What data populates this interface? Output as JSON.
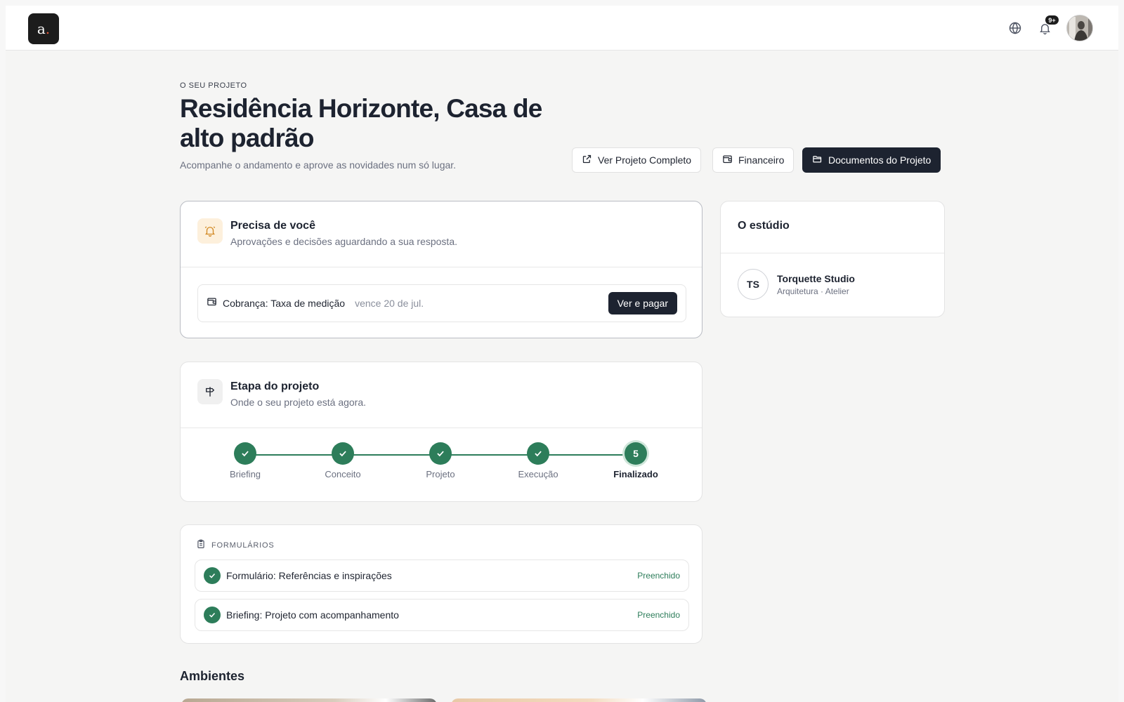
{
  "topbar": {
    "logo_letter": "a",
    "logo_dot": ".",
    "language_icon": "globe-icon",
    "notifications_icon": "bell-icon",
    "notifications_badge": "9+",
    "avatar_icon": "user-avatar"
  },
  "header": {
    "eyebrow": "O SEU PROJETO",
    "title": "Residência Horizonte, Casa de alto padrão",
    "subtitle": "Acompanhe o andamento e aprove as novidades num só lugar.",
    "buttons": [
      {
        "label": "Ver Projeto Completo",
        "icon": "external-link-icon"
      },
      {
        "label": "Financeiro",
        "icon": "wallet-icon"
      },
      {
        "label": "Documentos do Projeto",
        "icon": "folder-icon"
      }
    ]
  },
  "attention": {
    "icon": "bell-ring-icon",
    "title": "Precisa de você",
    "subtitle": "Aprovações e decisões aguardando a sua resposta.",
    "charge": {
      "icon": "wallet-icon",
      "label": "Cobrança: Taxa de medição",
      "due": "vence 20 de jul.",
      "action": "Ver e pagar"
    }
  },
  "stage": {
    "icon": "signpost-icon",
    "title": "Etapa do projeto",
    "subtitle": "Onde o seu projeto está agora.",
    "steps": [
      {
        "label": "Briefing",
        "status": "done"
      },
      {
        "label": "Conceito",
        "status": "done"
      },
      {
        "label": "Projeto",
        "status": "done"
      },
      {
        "label": "Execução",
        "status": "done"
      },
      {
        "label": "Finalizado",
        "status": "current",
        "number": "5"
      }
    ]
  },
  "forms": {
    "icon": "clipboard-icon",
    "heading": "FORMULÁRIOS",
    "items": [
      {
        "label": "Formulário: Referências e inspirações",
        "status": "Preenchido"
      },
      {
        "label": "Briefing: Projeto com acompanhamento",
        "status": "Preenchido"
      }
    ]
  },
  "studio": {
    "title": "O estúdio",
    "initials": "TS",
    "name": "Torquette Studio",
    "meta": "Arquitetura · Atelier"
  },
  "rooms": {
    "title": "Ambientes"
  },
  "colors": {
    "accent_green": "#2d7d5a",
    "dark": "#1d2330",
    "amber": "#d28a26",
    "logo_dot": "#e0563b"
  }
}
